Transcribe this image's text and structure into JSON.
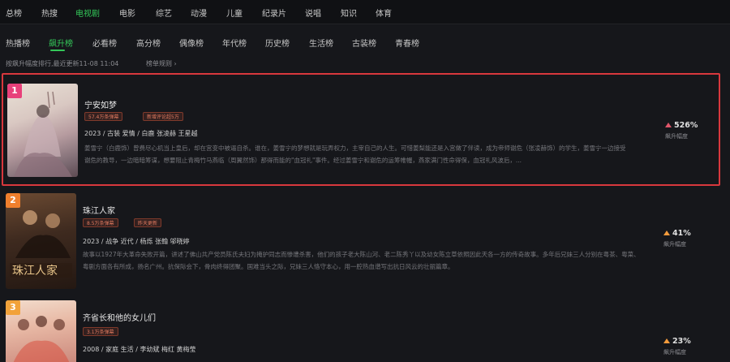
{
  "top_nav": {
    "items": [
      "总榜",
      "热搜",
      "电视剧",
      "电影",
      "综艺",
      "动漫",
      "儿童",
      "纪录片",
      "说唱",
      "知识",
      "体育"
    ],
    "active": "电视剧"
  },
  "sub_nav": {
    "items": [
      "热播榜",
      "飙升榜",
      "必看榜",
      "高分榜",
      "偶像榜",
      "年代榜",
      "历史榜",
      "生活榜",
      "古装榜",
      "青春榜"
    ],
    "active": "飙升榜"
  },
  "info": {
    "update_text": "按飙升幅度排行,最近更新11-08 11:04",
    "rules_text": "榜单规则",
    "rules_chevron": "›"
  },
  "items": [
    {
      "rank": "1",
      "title": "宁安如梦",
      "tags": [
        "57.4万条弹幕",
        "新增评论超5万"
      ],
      "meta": "2023 / 古装 爱情 / 白鹿 张凌赫 王星越",
      "desc": "姜雪宁（白鹿饰）曾费尽心机当上皇后，却在宫变中被逼自杀。谁在，姜雪宁的梦想就是玩弄权力，主宰自己的人生。可惜姜梨能还是入宫做了伴读，成为帝师谢危（张凌赫饰）的学生，姜雪宁一边接受谢危的教导，一边暗暗筹谋，想要阻止青梅竹马燕临（周翼然饰）那得而能的\"血冠礼\"事件。经过姜雪宁和谢危的运筹帷幄，燕家满门性命得保，血冠礼风波后，...",
      "trend_pct": "526%",
      "trend_label": "飙升幅度",
      "rank_color": "#e8407a"
    },
    {
      "rank": "2",
      "title": "珠江人家",
      "tags": [
        "8.5万条弹幕",
        "昨天更新"
      ],
      "meta": "2023 / 战争 近代 / 杨烁 张翰 邬晓婷",
      "desc": "故事以1927年大革命失败开篇，讲述了佛山共产党员陈氏夫妇为掩护同志而惨遭杀害，他们的孩子老大陈山河、老二陈秀丫以及幼女陈立草依照因此天各一方的传奇故事。多年后兄妹三人分别在粤茶、粤菜、粤剧方面各有所成，扬名广州。抗保际会下，骨肉终得团聚。国难当头之际，兄妹三人恪守本心，用一腔热血谱写出抗日风云的壮丽篇章。",
      "trend_pct": "41%",
      "trend_label": "飙升幅度",
      "rank_color": "#f07f2d"
    },
    {
      "rank": "3",
      "title": "齐省长和他的女儿们",
      "tags": [
        "3.1万条弹幕"
      ],
      "meta": "2008 / 家庭 生活 / 李幼斌 梅红 黄梅莹",
      "desc": "",
      "trend_pct": "23%",
      "trend_label": "飙升幅度",
      "rank_color": "#f2a23a"
    }
  ]
}
